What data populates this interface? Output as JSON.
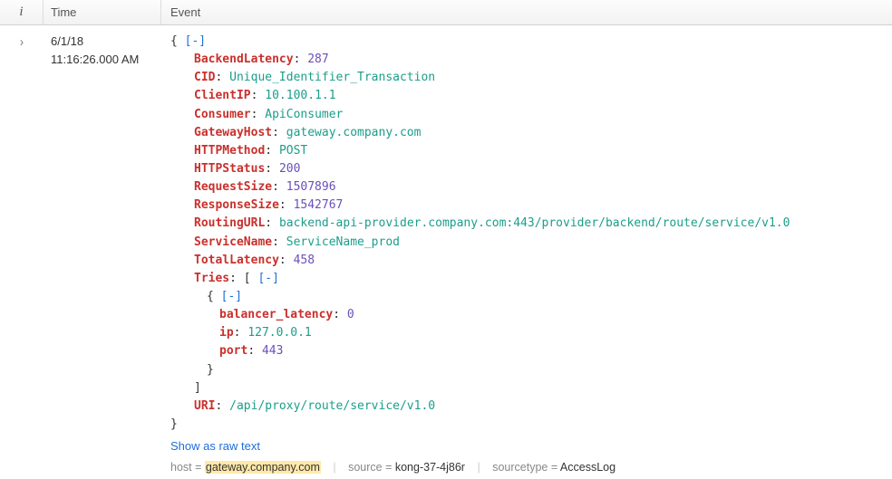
{
  "header": {
    "i": "i",
    "time": "Time",
    "event": "Event"
  },
  "row": {
    "date": "6/1/18",
    "time": "11:16:26.000 AM"
  },
  "toggle": {
    "collapse": "[-]"
  },
  "event": {
    "fields": {
      "BackendLatency": 287,
      "CID": "Unique_Identifier_Transaction",
      "ClientIP": "10.100.1.1",
      "Consumer": "ApiConsumer",
      "GatewayHost": "gateway.company.com",
      "HTTPMethod": "POST",
      "HTTPStatus": 200,
      "RequestSize": 1507896,
      "ResponseSize": 1542767,
      "RoutingURL": "backend-api-provider.company.com:443/provider/backend/route/service/v1.0",
      "ServiceName": "ServiceName_prod",
      "TotalLatency": 458
    },
    "tries_key": "Tries",
    "tries": [
      {
        "balancer_latency": 0,
        "ip": "127.0.0.1",
        "port": 443
      }
    ],
    "uri_key": "URI",
    "uri": "/api/proxy/route/service/v1.0"
  },
  "labels": {
    "BackendLatency": "BackendLatency",
    "CID": "CID",
    "ClientIP": "ClientIP",
    "Consumer": "Consumer",
    "GatewayHost": "GatewayHost",
    "HTTPMethod": "HTTPMethod",
    "HTTPStatus": "HTTPStatus",
    "RequestSize": "RequestSize",
    "ResponseSize": "ResponseSize",
    "RoutingURL": "RoutingURL",
    "ServiceName": "ServiceName",
    "TotalLatency": "TotalLatency",
    "balancer_latency": "balancer_latency",
    "ip": "ip",
    "port": "port"
  },
  "actions": {
    "show_raw": "Show as raw text"
  },
  "meta": {
    "host_label": "host = ",
    "host_value": "gateway.company.com",
    "source_label": "source = ",
    "source_value": "kong-37-4j86r",
    "sourcetype_label": "sourcetype = ",
    "sourcetype_value": "AccessLog"
  }
}
